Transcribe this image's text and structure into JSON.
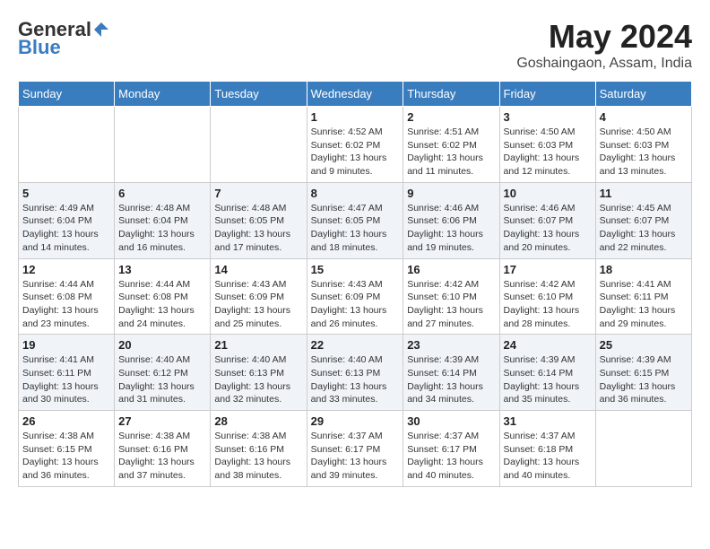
{
  "logo": {
    "general": "General",
    "blue": "Blue"
  },
  "title": {
    "month_year": "May 2024",
    "location": "Goshaingaon, Assam, India"
  },
  "headers": [
    "Sunday",
    "Monday",
    "Tuesday",
    "Wednesday",
    "Thursday",
    "Friday",
    "Saturday"
  ],
  "weeks": [
    {
      "alt": false,
      "days": [
        {
          "num": "",
          "info": ""
        },
        {
          "num": "",
          "info": ""
        },
        {
          "num": "",
          "info": ""
        },
        {
          "num": "1",
          "info": "Sunrise: 4:52 AM\nSunset: 6:02 PM\nDaylight: 13 hours and 9 minutes."
        },
        {
          "num": "2",
          "info": "Sunrise: 4:51 AM\nSunset: 6:02 PM\nDaylight: 13 hours and 11 minutes."
        },
        {
          "num": "3",
          "info": "Sunrise: 4:50 AM\nSunset: 6:03 PM\nDaylight: 13 hours and 12 minutes."
        },
        {
          "num": "4",
          "info": "Sunrise: 4:50 AM\nSunset: 6:03 PM\nDaylight: 13 hours and 13 minutes."
        }
      ]
    },
    {
      "alt": true,
      "days": [
        {
          "num": "5",
          "info": "Sunrise: 4:49 AM\nSunset: 6:04 PM\nDaylight: 13 hours and 14 minutes."
        },
        {
          "num": "6",
          "info": "Sunrise: 4:48 AM\nSunset: 6:04 PM\nDaylight: 13 hours and 16 minutes."
        },
        {
          "num": "7",
          "info": "Sunrise: 4:48 AM\nSunset: 6:05 PM\nDaylight: 13 hours and 17 minutes."
        },
        {
          "num": "8",
          "info": "Sunrise: 4:47 AM\nSunset: 6:05 PM\nDaylight: 13 hours and 18 minutes."
        },
        {
          "num": "9",
          "info": "Sunrise: 4:46 AM\nSunset: 6:06 PM\nDaylight: 13 hours and 19 minutes."
        },
        {
          "num": "10",
          "info": "Sunrise: 4:46 AM\nSunset: 6:07 PM\nDaylight: 13 hours and 20 minutes."
        },
        {
          "num": "11",
          "info": "Sunrise: 4:45 AM\nSunset: 6:07 PM\nDaylight: 13 hours and 22 minutes."
        }
      ]
    },
    {
      "alt": false,
      "days": [
        {
          "num": "12",
          "info": "Sunrise: 4:44 AM\nSunset: 6:08 PM\nDaylight: 13 hours and 23 minutes."
        },
        {
          "num": "13",
          "info": "Sunrise: 4:44 AM\nSunset: 6:08 PM\nDaylight: 13 hours and 24 minutes."
        },
        {
          "num": "14",
          "info": "Sunrise: 4:43 AM\nSunset: 6:09 PM\nDaylight: 13 hours and 25 minutes."
        },
        {
          "num": "15",
          "info": "Sunrise: 4:43 AM\nSunset: 6:09 PM\nDaylight: 13 hours and 26 minutes."
        },
        {
          "num": "16",
          "info": "Sunrise: 4:42 AM\nSunset: 6:10 PM\nDaylight: 13 hours and 27 minutes."
        },
        {
          "num": "17",
          "info": "Sunrise: 4:42 AM\nSunset: 6:10 PM\nDaylight: 13 hours and 28 minutes."
        },
        {
          "num": "18",
          "info": "Sunrise: 4:41 AM\nSunset: 6:11 PM\nDaylight: 13 hours and 29 minutes."
        }
      ]
    },
    {
      "alt": true,
      "days": [
        {
          "num": "19",
          "info": "Sunrise: 4:41 AM\nSunset: 6:11 PM\nDaylight: 13 hours and 30 minutes."
        },
        {
          "num": "20",
          "info": "Sunrise: 4:40 AM\nSunset: 6:12 PM\nDaylight: 13 hours and 31 minutes."
        },
        {
          "num": "21",
          "info": "Sunrise: 4:40 AM\nSunset: 6:13 PM\nDaylight: 13 hours and 32 minutes."
        },
        {
          "num": "22",
          "info": "Sunrise: 4:40 AM\nSunset: 6:13 PM\nDaylight: 13 hours and 33 minutes."
        },
        {
          "num": "23",
          "info": "Sunrise: 4:39 AM\nSunset: 6:14 PM\nDaylight: 13 hours and 34 minutes."
        },
        {
          "num": "24",
          "info": "Sunrise: 4:39 AM\nSunset: 6:14 PM\nDaylight: 13 hours and 35 minutes."
        },
        {
          "num": "25",
          "info": "Sunrise: 4:39 AM\nSunset: 6:15 PM\nDaylight: 13 hours and 36 minutes."
        }
      ]
    },
    {
      "alt": false,
      "days": [
        {
          "num": "26",
          "info": "Sunrise: 4:38 AM\nSunset: 6:15 PM\nDaylight: 13 hours and 36 minutes."
        },
        {
          "num": "27",
          "info": "Sunrise: 4:38 AM\nSunset: 6:16 PM\nDaylight: 13 hours and 37 minutes."
        },
        {
          "num": "28",
          "info": "Sunrise: 4:38 AM\nSunset: 6:16 PM\nDaylight: 13 hours and 38 minutes."
        },
        {
          "num": "29",
          "info": "Sunrise: 4:37 AM\nSunset: 6:17 PM\nDaylight: 13 hours and 39 minutes."
        },
        {
          "num": "30",
          "info": "Sunrise: 4:37 AM\nSunset: 6:17 PM\nDaylight: 13 hours and 40 minutes."
        },
        {
          "num": "31",
          "info": "Sunrise: 4:37 AM\nSunset: 6:18 PM\nDaylight: 13 hours and 40 minutes."
        },
        {
          "num": "",
          "info": ""
        }
      ]
    }
  ]
}
